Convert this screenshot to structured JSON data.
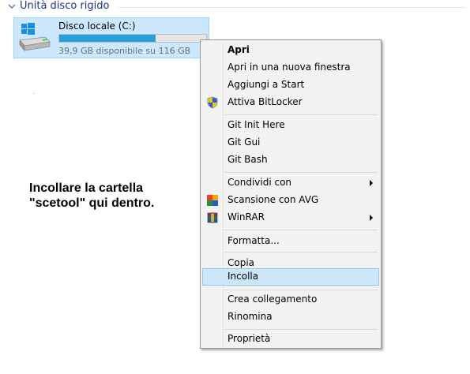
{
  "section": {
    "title": "Unità disco rigido"
  },
  "drive": {
    "name": "Disco locale (C:)",
    "free_text": "39,9 GB disponibile su 116 GB",
    "used_fraction": 0.656
  },
  "instruction": {
    "line1": "Incollare la cartella",
    "line2": "\"scetool\" qui dentro."
  },
  "context_menu": {
    "items": [
      {
        "label": "Apri",
        "bold": true
      },
      {
        "label": "Apri in una nuova finestra"
      },
      {
        "label": "Aggiungi a Start"
      },
      {
        "label": "Attiva BitLocker",
        "icon": "shield-icon"
      },
      {
        "label": "Git Init Here"
      },
      {
        "label": "Git Gui"
      },
      {
        "label": "Git Bash"
      },
      {
        "label": "Condividi con",
        "submenu": true
      },
      {
        "label": "Scansione con AVG",
        "icon": "avg-icon"
      },
      {
        "label": "WinRAR",
        "icon": "winrar-icon",
        "submenu": true
      },
      {
        "label": "Formatta..."
      },
      {
        "label": "Copia"
      },
      {
        "label": "Incolla",
        "highlighted": true
      },
      {
        "label": "Crea collegamento"
      },
      {
        "label": "Rinomina"
      },
      {
        "label": "Proprietà"
      }
    ]
  },
  "colors": {
    "section_title": "#1e3287",
    "tile_background": "#cce8ff",
    "usage_fill": "#26a0da",
    "menu_highlight": "#cde6f7"
  }
}
